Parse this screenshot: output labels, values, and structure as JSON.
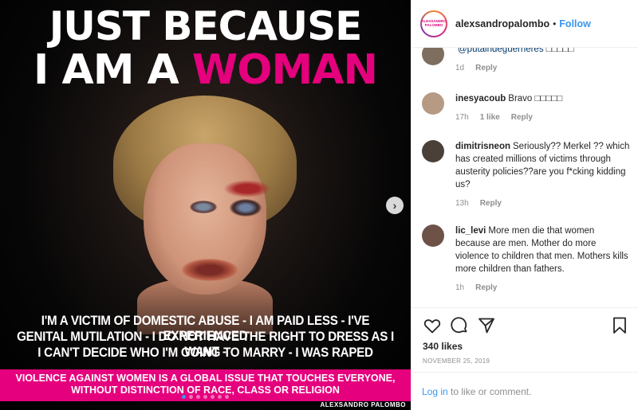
{
  "post": {
    "headline_line1": "JUST BECAUSE",
    "headline_line2_white": "I AM A ",
    "headline_line2_pink": "WOMAN",
    "body_line1": "I'M A VICTIM OF DOMESTIC ABUSE - I AM PAID LESS - I'VE EXPERIENCED",
    "body_line2": "GENITAL MUTILATION - I DO NOT HAVE THE RIGHT TO DRESS AS I WANT -",
    "body_line3": "I CAN'T DECIDE WHO I'M GOING TO MARRY - I WAS RAPED",
    "band_line1": "VIOLENCE AGAINST WOMEN IS A GLOBAL ISSUE THAT TOUCHES EVERYONE,",
    "band_line2": "WITHOUT DISTINCTION OF RACE, CLASS OR RELIGION",
    "signature": "ALEXSANDRO PALOMBO",
    "accent_color": "#e5007d"
  },
  "header": {
    "logo_line1": "ALEXSANDRO",
    "logo_line2": "PALOMBO",
    "username": "alexsandropalombo",
    "dot": "•",
    "follow_label": "Follow"
  },
  "comments": [
    {
      "username": "",
      "mention": "@putaindeguerrieres",
      "text": " □□□□□",
      "time": "1d",
      "likes": "",
      "reply": "Reply"
    },
    {
      "username": "inesyacoub",
      "mention": "",
      "text": "Bravo □□□□□",
      "time": "17h",
      "likes": "1 like",
      "reply": "Reply"
    },
    {
      "username": "dimitrisneon",
      "mention": "",
      "text": "Seriously?? Merkel ?? which has created millions of victims through austerity policies??are you f*cking kidding us?",
      "time": "13h",
      "likes": "",
      "reply": "Reply"
    },
    {
      "username": "lic_levi",
      "mention": "",
      "text": "More men die that women because are men. Mother do more violence to children that men. Mothers kills more children than fathers.",
      "time": "1h",
      "likes": "",
      "reply": "Reply"
    }
  ],
  "actions": {
    "likes": "340 likes",
    "date": "NOVEMBER 25, 2019",
    "icons": [
      "heart-icon",
      "comment-icon",
      "share-icon",
      "bookmark-icon"
    ]
  },
  "login": {
    "link": "Log in",
    "rest": " to like or comment."
  }
}
